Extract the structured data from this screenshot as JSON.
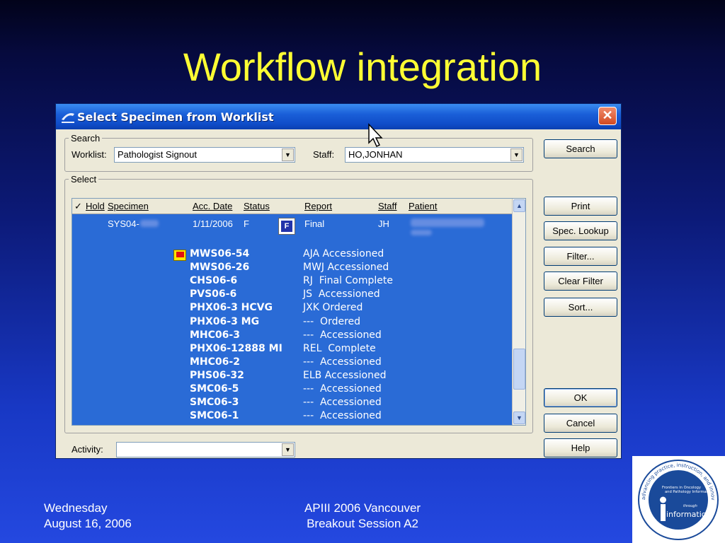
{
  "slide": {
    "title": "Workflow integration",
    "footer_left": [
      "Wednesday",
      "August 16, 2006"
    ],
    "footer_center": [
      "APIII 2006 Vancouver",
      "Breakout Session A2"
    ]
  },
  "window": {
    "title": "Select Specimen from Worklist",
    "close_symbol": "✕"
  },
  "search": {
    "group_label": "Search",
    "worklist_label": "Worklist:",
    "worklist_value": "Pathologist Signout",
    "staff_label": "Staff:",
    "staff_value": "HO,JONHAN"
  },
  "select": {
    "group_label": "Select",
    "columns": {
      "check": "✓",
      "hold": "Hold",
      "specimen": "Specimen",
      "acc_date": "Acc. Date",
      "status": "Status",
      "report": "Report",
      "staff": "Staff",
      "patient": "Patient"
    },
    "first_row": {
      "specimen": "SYS04-",
      "acc_date": "1/11/2006",
      "status": "F",
      "report": "Final",
      "staff": "JH",
      "f_icon": "F"
    },
    "rows": [
      {
        "specimen": "MWS06-54",
        "detail": "AJA Accessioned"
      },
      {
        "specimen": "MWS06-26",
        "detail": "MWJ Accessioned"
      },
      {
        "specimen": "CHS06-6",
        "detail": "RJ  Final Complete"
      },
      {
        "specimen": "PVS06-6",
        "detail": "JS  Accessioned"
      },
      {
        "specimen": "PHX06-3  HCVG",
        "detail": "JXK Ordered"
      },
      {
        "specimen": "PHX06-3  MG",
        "detail": "---  Ordered"
      },
      {
        "specimen": "MHC06-3",
        "detail": "---  Accessioned"
      },
      {
        "specimen": "PHX06-12888  MI",
        "detail": "REL  Complete"
      },
      {
        "specimen": "MHC06-2",
        "detail": "---  Accessioned"
      },
      {
        "specimen": "PHS06-32",
        "detail": "ELB Accessioned"
      },
      {
        "specimen": "SMC06-5",
        "detail": "---  Accessioned"
      },
      {
        "specimen": "SMC06-3",
        "detail": "---  Accessioned"
      },
      {
        "specimen": "SMC06-1",
        "detail": "---  Accessioned"
      }
    ]
  },
  "activity": {
    "label": "Activity:",
    "value": ""
  },
  "buttons": {
    "search": "Search",
    "print": "Print",
    "spec_lookup": "Spec. Lookup",
    "filter": "Filter...",
    "clear_filter": "Clear Filter",
    "sort": "Sort...",
    "ok": "OK",
    "cancel": "Cancel",
    "help": "Help"
  },
  "logo": {
    "ring_text": "advancing practice, instruction, and innovation",
    "line1": "Frontiers in Oncology",
    "line2": "and Pathology Informatics",
    "through": "through",
    "word": "informatics"
  },
  "colors": {
    "title_yellow": "#ffff33",
    "selection_blue": "#2a6bd6",
    "logo_blue": "#1a4a9a"
  }
}
